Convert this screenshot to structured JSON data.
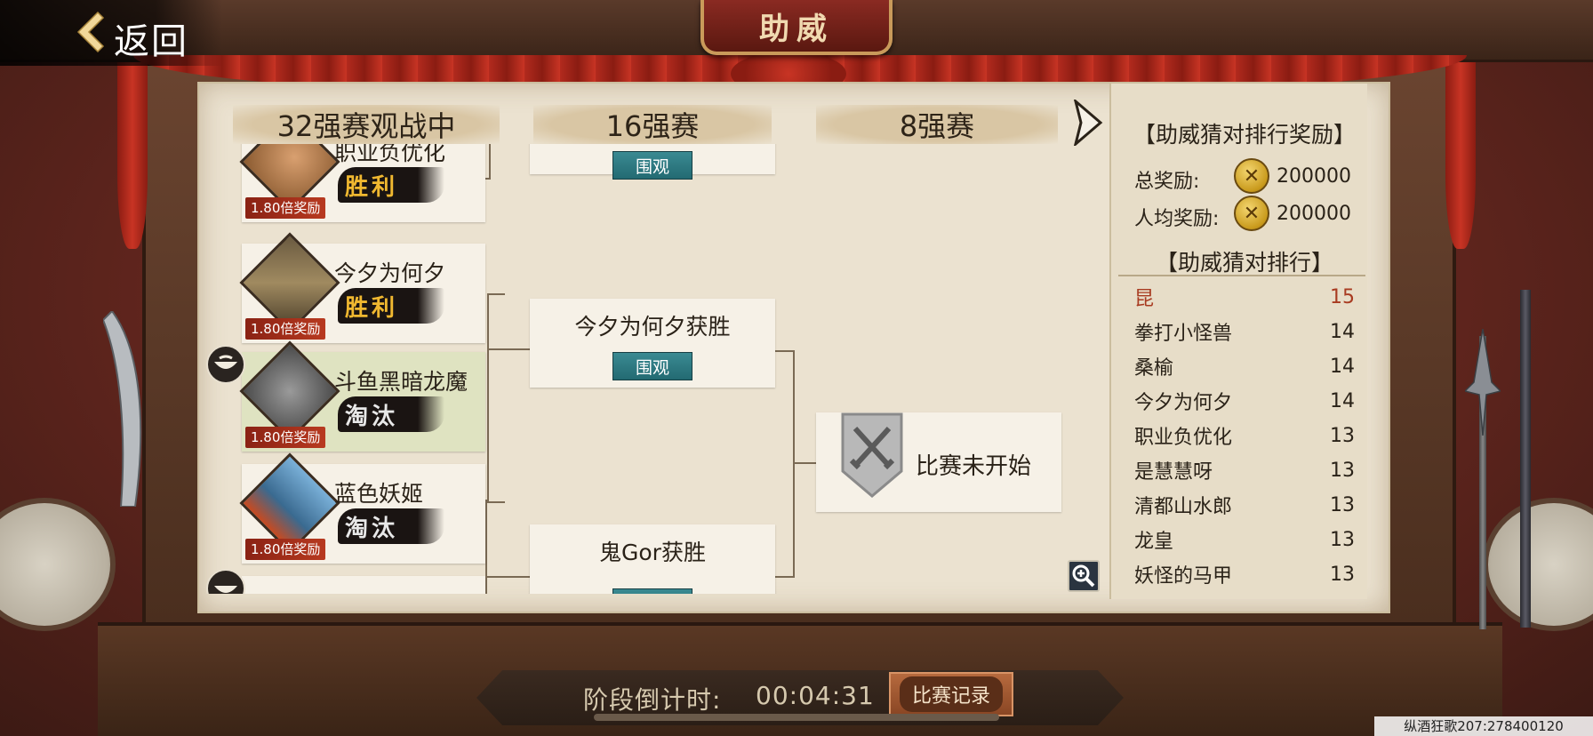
{
  "header": {
    "back_label": "返回",
    "title": "助威"
  },
  "rounds": {
    "r32": "32强赛观战中",
    "r16": "16强赛",
    "r8": "8强赛"
  },
  "players": [
    {
      "name": "职业负优化",
      "result": "胜利",
      "multiplier": "1.80倍奖励"
    },
    {
      "name": "今夕为何夕",
      "result": "胜利",
      "multiplier": "1.80倍奖励"
    },
    {
      "name": "斗鱼黑暗龙魔",
      "result": "淘汰",
      "multiplier": "1.80倍奖励"
    },
    {
      "name": "蓝色妖姬",
      "result": "淘汰",
      "multiplier": "1.80倍奖励"
    }
  ],
  "round16": [
    {
      "text": "",
      "watch": "围观"
    },
    {
      "text": "今夕为何夕获胜",
      "watch": "围观"
    },
    {
      "text": "鬼Gor获胜",
      "watch": "围观"
    }
  ],
  "round8": {
    "status": "比赛未开始"
  },
  "ranking": {
    "reward_title": "【助威猜对排行奖励】",
    "total_label": "总奖励:",
    "total_value": "200000",
    "avg_label": "人均奖励:",
    "avg_value": "200000",
    "list_title": "【助威猜对排行】",
    "rows": [
      {
        "name": "昆",
        "score": "15"
      },
      {
        "name": "拳打小怪兽",
        "score": "14"
      },
      {
        "name": "桑榆",
        "score": "14"
      },
      {
        "name": "今夕为何夕",
        "score": "14"
      },
      {
        "name": "职业负优化",
        "score": "13"
      },
      {
        "name": "是慧慧呀",
        "score": "13"
      },
      {
        "name": "清都山水郎",
        "score": "13"
      },
      {
        "name": "龙皇",
        "score": "13"
      },
      {
        "name": "妖怪的马甲",
        "score": "13"
      }
    ]
  },
  "footer": {
    "countdown_label": "阶段倒计时:",
    "countdown_value": "00:04:31",
    "record_button": "比赛记录",
    "player_id": "纵酒狂歌207:278400120"
  },
  "colors": {
    "win": "#f0b830",
    "watch_button": "#2e7a82",
    "top_rank": "#a83a20"
  }
}
